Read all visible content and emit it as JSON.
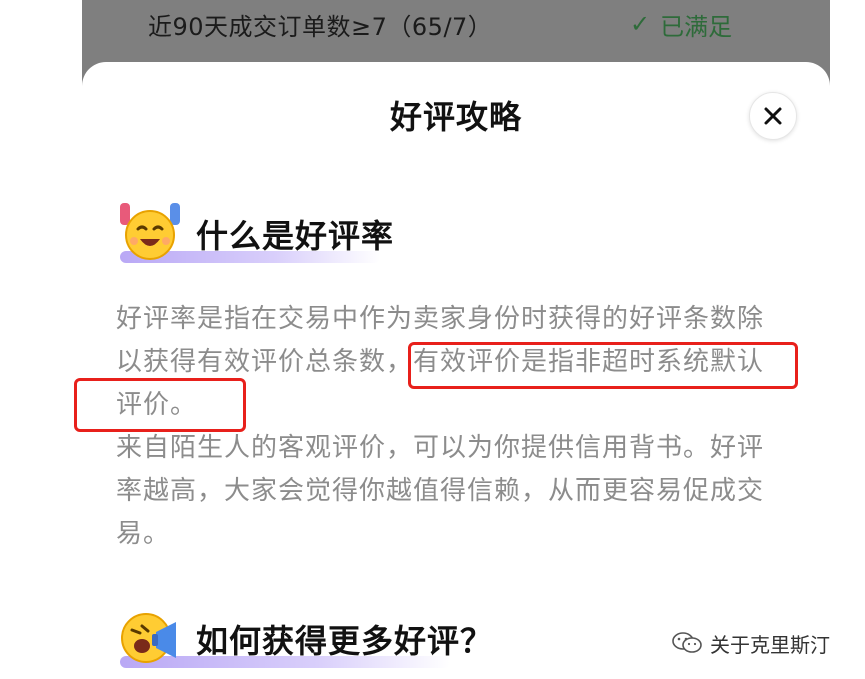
{
  "background_row": {
    "text": "近90天成交订单数≥7（65/7）",
    "status": "已满足"
  },
  "sheet": {
    "title": "好评攻略",
    "close_label": "×"
  },
  "sections": [
    {
      "heading": "什么是好评率",
      "paragraph_lines": [
        "好评率是指在交易中作为卖家身份时获得的好评条数除",
        "以获得有效评价总条数，有效评价是指非超时系统默认",
        "评价。",
        "来自陌生人的客观评价，可以为你提供信用背书。好评",
        "率越高，大家会觉得你越值得信赖，从而更容易促成交",
        "易。"
      ]
    },
    {
      "heading": "如何获得更多好评？"
    }
  ],
  "watermark": {
    "text": "关于克里斯汀"
  },
  "colors": {
    "highlight_border": "#e8201b",
    "status_green": "#2e6b3a",
    "underline_purple": "#b9a8f5"
  },
  "icons": [
    "check-icon",
    "close-icon",
    "cheering-emoji-icon",
    "shouting-emoji-icon",
    "wechat-icon"
  ]
}
